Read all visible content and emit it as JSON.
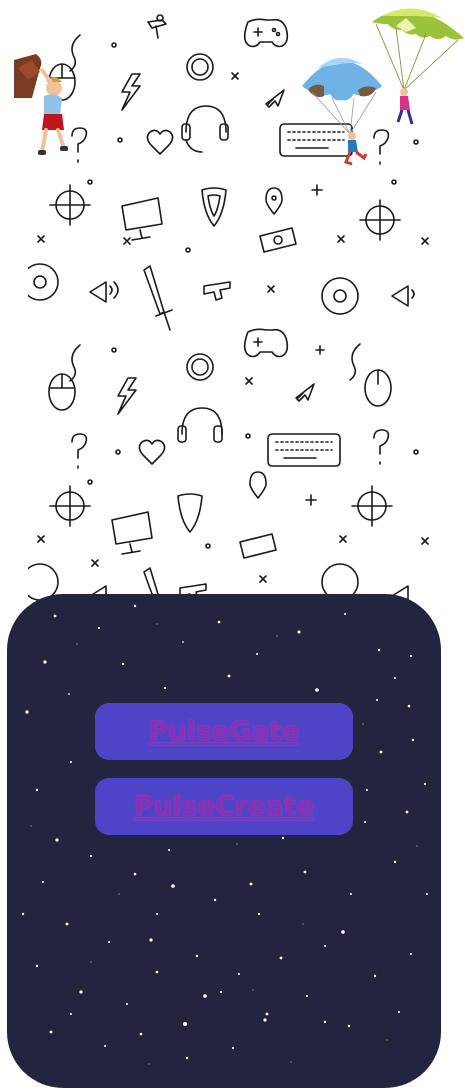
{
  "background": {
    "pattern_icon": "gaming-doodle-pattern",
    "color": "#ffffff"
  },
  "illustrations": {
    "climber": "hanging-climber-figure",
    "parachute_blue": "blue-parachute-skydiver",
    "parachute_green": "green-parachute-skydiver"
  },
  "panel": {
    "color": "#23253e",
    "style": "starry-night"
  },
  "links": [
    {
      "label": "PulseGate"
    },
    {
      "label": "PulseCreate"
    }
  ],
  "colors": {
    "button_bg": "#4e44c8",
    "button_text": "#8a2fb0"
  }
}
